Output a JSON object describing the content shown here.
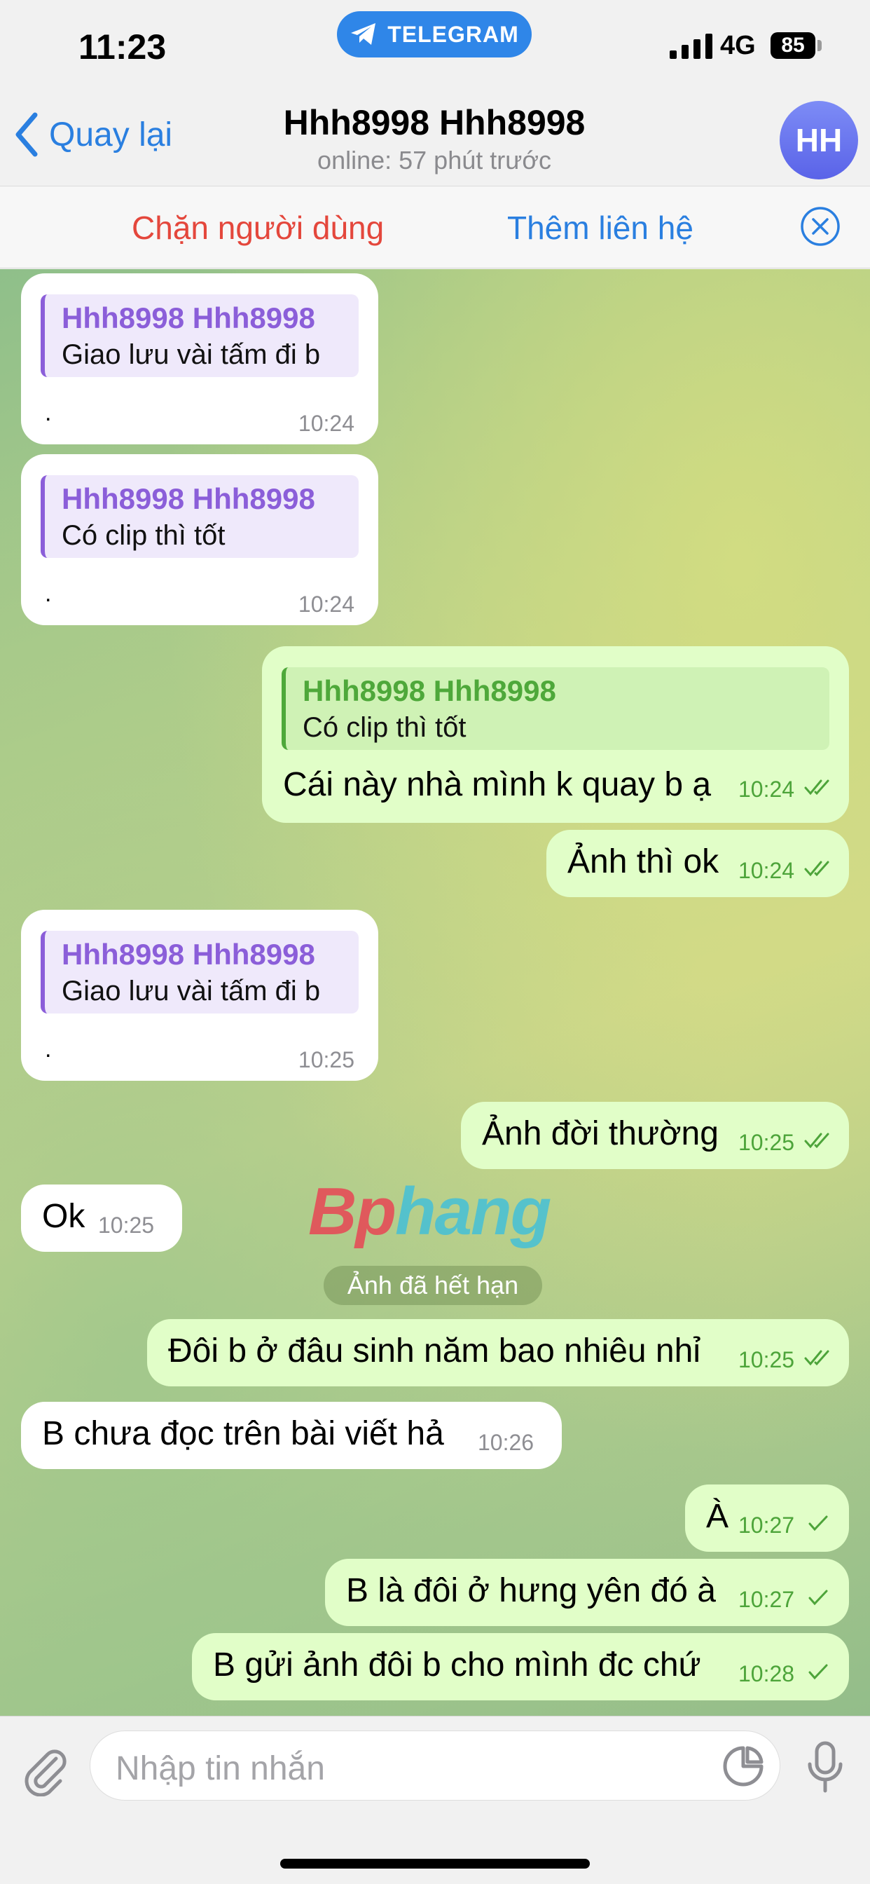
{
  "status_bar": {
    "time": "11:23",
    "app_pill": "TELEGRAM",
    "network": "4G",
    "battery": "85"
  },
  "header": {
    "back_label": "Quay lại",
    "title": "Hhh8998 Hhh8998",
    "subtitle": "online: 57 phút trước",
    "avatar_initials": "HH"
  },
  "action_bar": {
    "block_label": "Chặn người dùng",
    "add_contact_label": "Thêm liên hệ"
  },
  "messages": [
    {
      "dir": "in",
      "reply_name": "Hhh8998 Hhh8998",
      "reply_text": "Giao lưu vài tấm đi b",
      "text": ".",
      "time": "10:24"
    },
    {
      "dir": "in",
      "reply_name": "Hhh8998 Hhh8998",
      "reply_text": "Có clip thì tốt",
      "text": ".",
      "time": "10:24"
    },
    {
      "dir": "out",
      "reply_name": "Hhh8998 Hhh8998",
      "reply_text": "Có clip thì tốt",
      "text": "Cái này nhà mình k quay b ạ",
      "time": "10:24",
      "read": true
    },
    {
      "dir": "out",
      "text": "Ảnh thì ok",
      "time": "10:24",
      "read": true
    },
    {
      "dir": "in",
      "reply_name": "Hhh8998 Hhh8998",
      "reply_text": "Giao lưu vài tấm đi b",
      "text": ".",
      "time": "10:25"
    },
    {
      "dir": "out",
      "text": "Ảnh đời thường",
      "time": "10:25",
      "read": true
    },
    {
      "dir": "in",
      "text": "Ok",
      "time": "10:25"
    },
    {
      "dir": "out",
      "text": "Đôi b ở đâu sinh năm bao nhiêu nhỉ",
      "time": "10:25",
      "read": true
    },
    {
      "dir": "in",
      "text": "B chưa đọc trên bài viết hả",
      "time": "10:26"
    },
    {
      "dir": "out",
      "text": "À",
      "time": "10:27",
      "read": false
    },
    {
      "dir": "out",
      "text": "B là đôi ở hưng yên đó à",
      "time": "10:27",
      "read": false
    },
    {
      "dir": "out",
      "text": "B gửi ảnh đôi b cho mình đc chứ",
      "time": "10:28",
      "read": false
    }
  ],
  "system_notice": "Ảnh đã hết hạn",
  "watermark": {
    "part1": "Bp",
    "part2": "hang"
  },
  "composer": {
    "placeholder": "Nhập tin nhắn"
  },
  "colors": {
    "accent": "#2a7fe0",
    "danger": "#e4473c",
    "outgoing_bubble": "#e1fec8",
    "reply_purple": "#8b5ed9",
    "reply_green": "#4ea83a"
  },
  "icons": [
    "paperclip-icon",
    "sticker-icon",
    "microphone-icon",
    "close-icon",
    "chevron-left-icon",
    "telegram-plane-icon",
    "signal-icon"
  ]
}
